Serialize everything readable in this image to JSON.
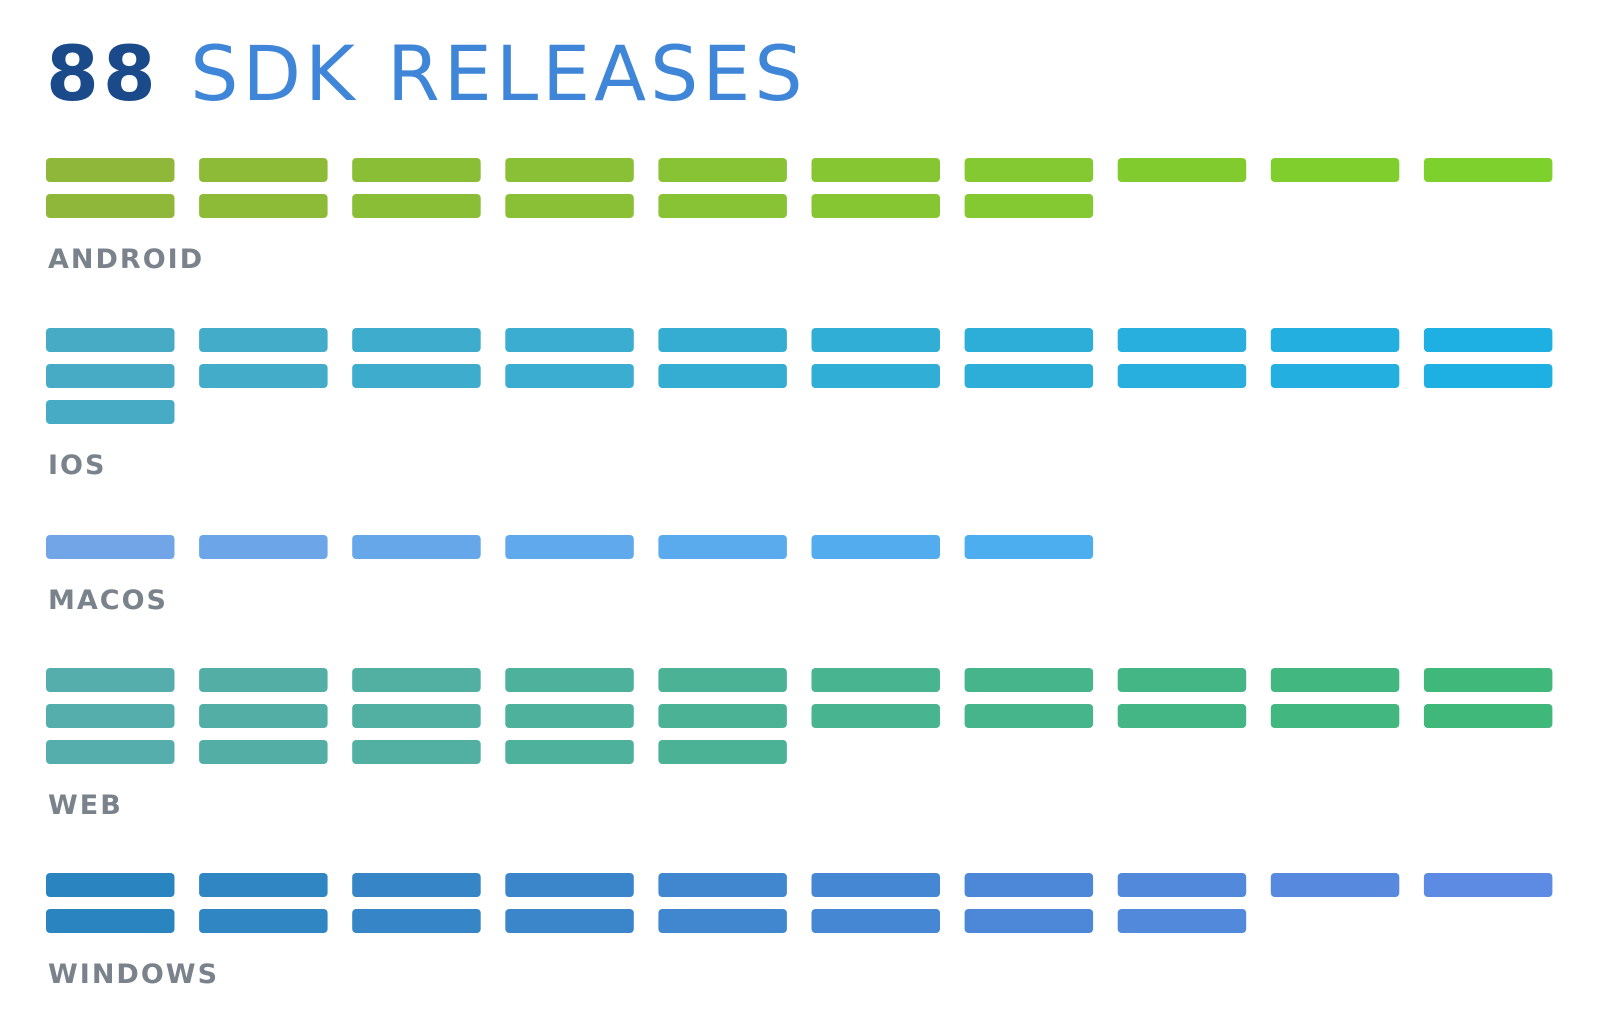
{
  "header": {
    "count": "88",
    "label": "SDK RELEASES"
  },
  "chart_data": {
    "type": "bar",
    "title": "88 SDK RELEASES",
    "units_per_row": 10,
    "categories": [
      "ANDROID",
      "IOS",
      "MACOS",
      "WEB",
      "WINDOWS"
    ],
    "values": [
      17,
      21,
      7,
      25,
      18
    ],
    "series": [
      {
        "name": "ANDROID",
        "value": 17,
        "color_start": "#8fb83a",
        "color_end": "#7ed12c"
      },
      {
        "name": "IOS",
        "value": 21,
        "color_start": "#47abc6",
        "color_end": "#1fb0e3"
      },
      {
        "name": "MACOS",
        "value": 7,
        "color_start": "#72a4e8",
        "color_end": "#3bb3f3"
      },
      {
        "name": "WEB",
        "value": 25,
        "color_start": "#56aeac",
        "color_end": "#3fb87a"
      },
      {
        "name": "WINDOWS",
        "value": 18,
        "color_start": "#2a84bf",
        "color_end": "#5d8ae3"
      }
    ]
  }
}
